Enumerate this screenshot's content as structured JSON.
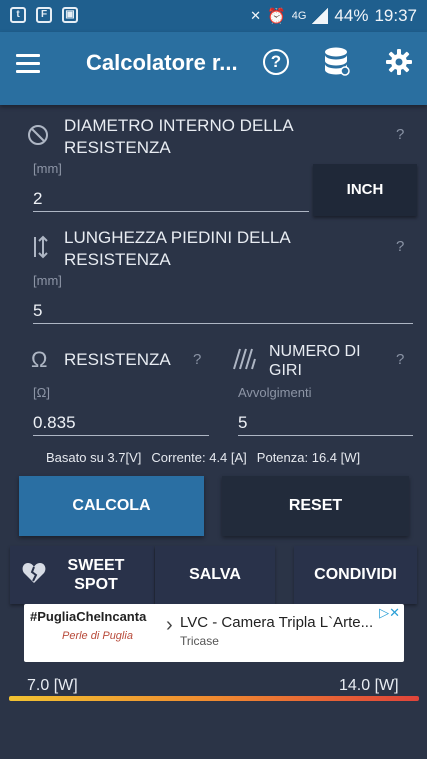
{
  "status_bar": {
    "network_label": "4G",
    "battery": "44%",
    "time": "19:37"
  },
  "app_bar": {
    "title": "Calcolatore r..."
  },
  "fields": {
    "diametro": {
      "label_line1": "DIAMETRO INTERNO DELLA",
      "label_line2": "RESISTENZA",
      "unit": "[mm]",
      "value": "2",
      "help": "?"
    },
    "inch_button": "INCH",
    "lunghezza": {
      "label_line1": "LUNGHEZZA PIEDINI DELLA",
      "label_line2": "RESISTENZA",
      "unit": "[mm]",
      "value": "5",
      "help": "?"
    },
    "resistenza": {
      "symbol": "Ω",
      "label": "RESISTENZA",
      "unit": "[Ω]",
      "value": "0.835",
      "help": "?"
    },
    "giri": {
      "label_line1": "NUMERO DI",
      "label_line2": "GIRI",
      "unit": "Avvolgimenti",
      "value": "5",
      "help": "?"
    }
  },
  "info": {
    "basato": "Basato su 3.7[V]",
    "corrente": "Corrente: 4.4 [A]",
    "potenza": "Potenza: 16.4 [W]"
  },
  "buttons": {
    "calcola": "CALCOLA",
    "reset": "RESET",
    "sweet_line1": "SWEET",
    "sweet_line2": "SPOT",
    "salva": "SALVA",
    "condividi": "CONDIVIDI"
  },
  "ad": {
    "brand": "#PugliaCheIncanta",
    "logo_text": "Perle di Puglia",
    "headline": "LVC - Camera Tripla L`Arte...",
    "subline": "Tricase"
  },
  "range": {
    "min": "7.0 [W]",
    "max": "14.0 [W]"
  },
  "colors": {
    "status_bar": "#1f5f8e",
    "app_bar": "#2a6fa0",
    "background": "#2b3447",
    "calcola_button": "#2a6fa3",
    "range_start": "#f1c232",
    "range_end": "#e0443a"
  }
}
